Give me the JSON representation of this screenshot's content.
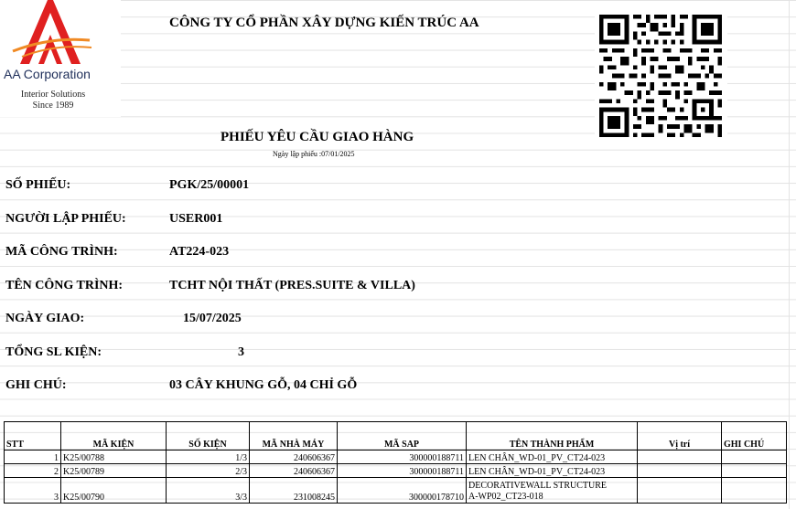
{
  "logo": {
    "name": "AA Corporation",
    "tagline": "Interior Solutions",
    "since": "Since 1989",
    "colors": {
      "red": "#e02020",
      "orange": "#f08a24",
      "navy": "#1f2f5a"
    }
  },
  "company_name": "CÔNG TY CỔ PHẦN XÂY DỰNG KIẾN TRÚC AA",
  "qr_icon": "qr-code",
  "title": "PHIẾU YÊU CẦU GIAO HÀNG",
  "created_date": "Ngày lập phiếu :07/01/2025",
  "fields": {
    "so_phieu": {
      "label": "SỐ PHIẾU:",
      "value": "PGK/25/00001"
    },
    "nguoi_lap": {
      "label": "NGƯỜI LẬP PHIẾU:",
      "value": "USER001"
    },
    "ma_cong_trinh": {
      "label": "MÃ CÔNG TRÌNH:",
      "value": "AT224-023"
    },
    "ten_cong_trinh": {
      "label": "TÊN CÔNG TRÌNH:",
      "value": "TCHT NỘI THẤT (PRES.SUITE & VILLA)"
    },
    "ngay_giao": {
      "label": "NGÀY GIAO:",
      "value": "15/07/2025"
    },
    "tong_sl": {
      "label": "TỔNG SL KIỆN:",
      "value": "3"
    },
    "ghi_chu": {
      "label": "GHI CHÚ:",
      "value": "03 CÂY KHUNG GỖ, 04 CHỈ GỖ"
    }
  },
  "table": {
    "headers": [
      "STT",
      "MÃ KIỆN",
      "SỐ KIỆN",
      "MÃ NHÀ MÁY",
      "MÃ SAP",
      "TÊN THÀNH PHẨM",
      "Vị trí",
      "GHI CHÚ"
    ],
    "rows": [
      {
        "stt": "1",
        "ma_kien": "K25/00788",
        "so_kien": "1/3",
        "ma_nha_may": "240606367",
        "ma_sap": "300000188711",
        "ten": "LEN CHÂN_WD-01_PV_CT24-023",
        "ten2": "",
        "vi_tri": "",
        "ghi_chu": ""
      },
      {
        "stt": "2",
        "ma_kien": "K25/00789",
        "so_kien": "2/3",
        "ma_nha_may": "240606367",
        "ma_sap": "300000188711",
        "ten": "LEN CHÂN_WD-01_PV_CT24-023",
        "ten2": "",
        "vi_tri": "",
        "ghi_chu": ""
      },
      {
        "stt": "3",
        "ma_kien": "K25/00790",
        "so_kien": "3/3",
        "ma_nha_may": "231008245",
        "ma_sap": "300000178710",
        "ten": "DECORATIVEWALL STRUCTURE",
        "ten2": "A-WP02_CT23-018",
        "vi_tri": "",
        "ghi_chu": ""
      }
    ]
  }
}
